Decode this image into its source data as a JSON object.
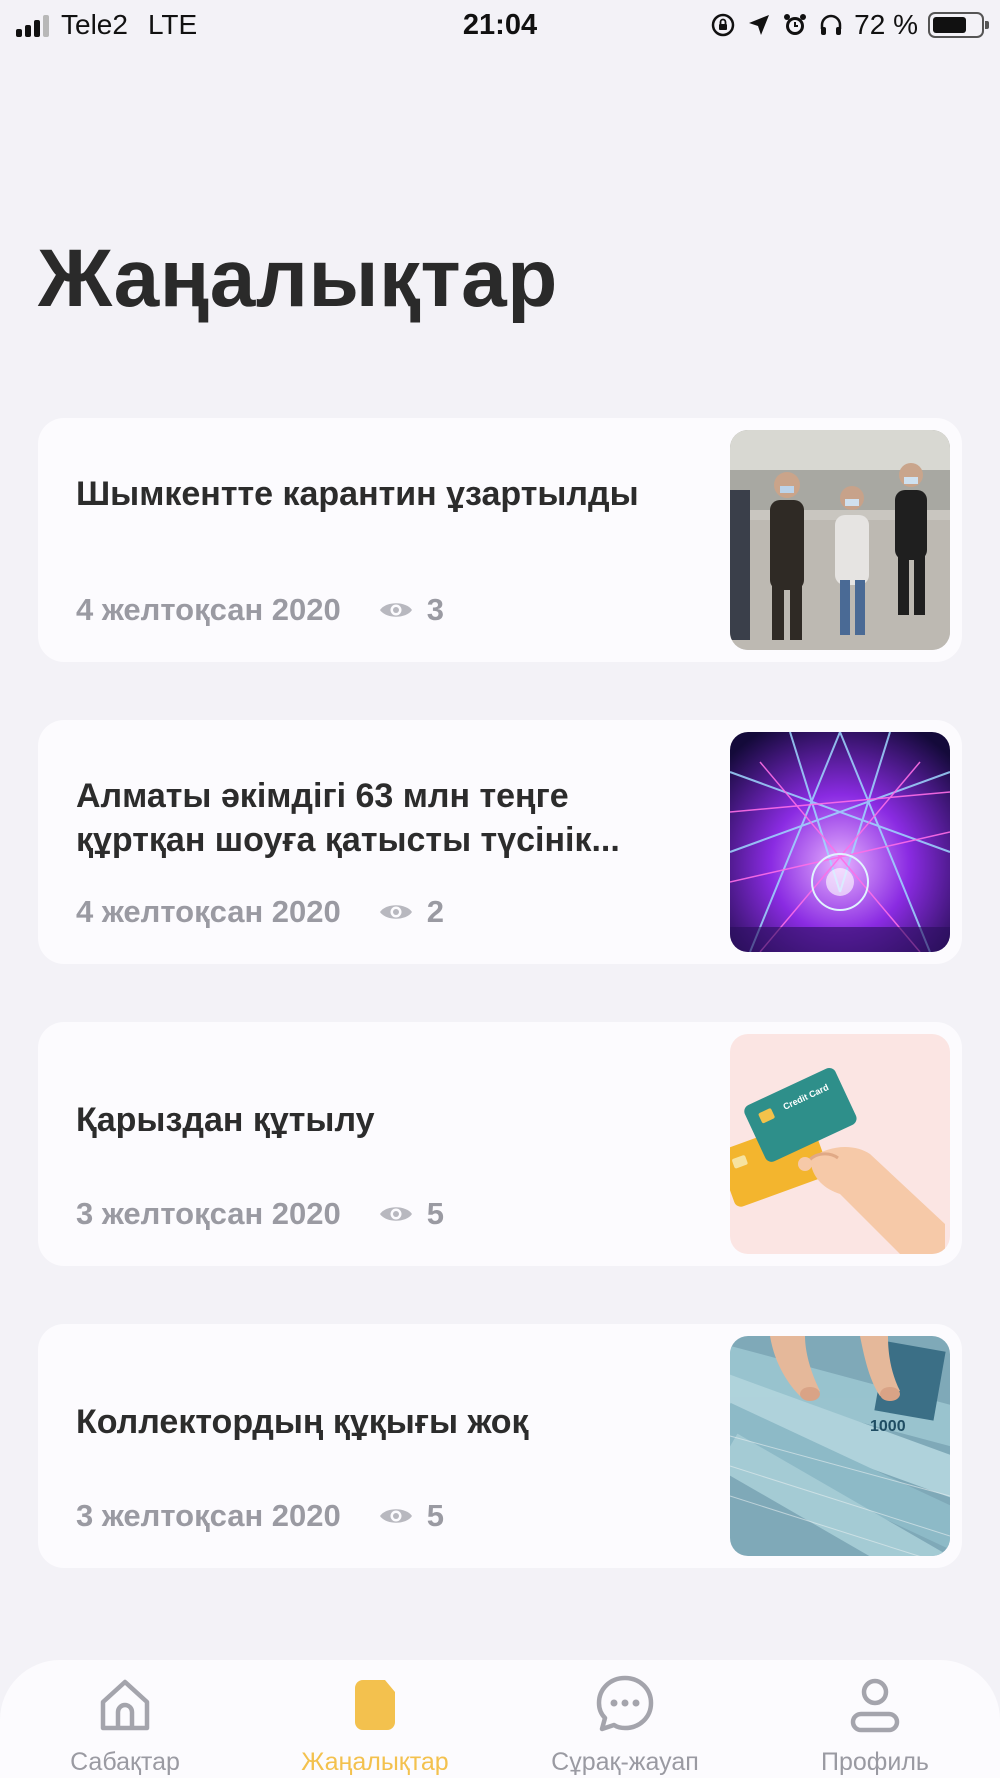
{
  "status_bar": {
    "carrier": "Tele2",
    "network": "LTE",
    "time": "21:04",
    "battery_percent": "72 %",
    "battery_level": 0.72
  },
  "page_title": "Жаңалықтар",
  "news": [
    {
      "title": "Шымкентте карантин ұзартылды",
      "date": "4 желтоқсан 2020",
      "views": "3",
      "thumbnail": "people-wearing-masks-photo"
    },
    {
      "title": "Алматы әкімдігі 63 млн теңге құртқан шоуға қатысты түсінік...",
      "date": "4 желтоқсан 2020",
      "views": "2",
      "thumbnail": "laser-light-show-photo"
    },
    {
      "title": "Қарыздан құтылу",
      "date": "3 желтоқсан 2020",
      "views": "5",
      "thumbnail": "credit-cards-illustration",
      "card_text": "Credit Card"
    },
    {
      "title": "Коллектордың құқығы жоқ",
      "date": "3 желтоқсан 2020",
      "views": "5",
      "thumbnail": "tenge-banknotes-photo"
    }
  ],
  "tabs": [
    {
      "label": "Сабақтар",
      "icon": "home-icon",
      "active": false
    },
    {
      "label": "Жаңалықтар",
      "icon": "news-icon",
      "active": true
    },
    {
      "label": "Сұрақ-жауап",
      "icon": "chat-bubble-icon",
      "active": false
    },
    {
      "label": "Профиль",
      "icon": "profile-icon",
      "active": false
    }
  ],
  "colors": {
    "background": "#f3f2f7",
    "card": "#fcfbfe",
    "accent": "#f3c14e",
    "muted": "#9a9aa2",
    "title": "#2a2a2a"
  }
}
